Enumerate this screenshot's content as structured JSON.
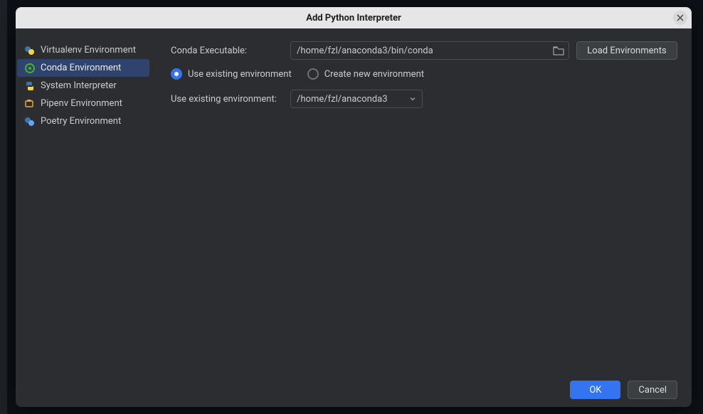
{
  "dialog": {
    "title": "Add Python Interpreter"
  },
  "sidebar": {
    "items": [
      {
        "label": "Virtualenv Environment",
        "icon": "python-dual"
      },
      {
        "label": "Conda Environment",
        "icon": "conda"
      },
      {
        "label": "System Interpreter",
        "icon": "python"
      },
      {
        "label": "Pipenv Environment",
        "icon": "pipenv"
      },
      {
        "label": "Poetry Environment",
        "icon": "poetry"
      }
    ]
  },
  "form": {
    "conda_exec_label": "Conda Executable:",
    "conda_exec_value": "/home/fzl/anaconda3/bin/conda",
    "load_env_label": "Load Environments",
    "radio_use_existing": "Use existing environment",
    "radio_create_new": "Create new environment",
    "use_existing_label": "Use existing environment:",
    "use_existing_value": "/home/fzl/anaconda3"
  },
  "buttons": {
    "ok": "OK",
    "cancel": "Cancel"
  }
}
